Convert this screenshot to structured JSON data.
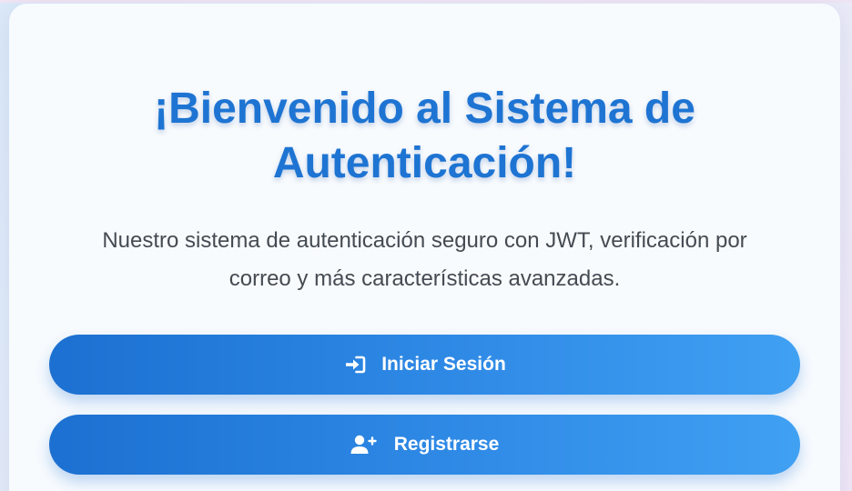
{
  "welcome": {
    "title_line1": "¡Bienvenido al Sistema de",
    "title_line2": "Autenticación!",
    "description_line1": "Nuestro sistema de autenticación seguro con JWT, verificación por",
    "description_line2": "correo y más características avanzadas."
  },
  "actions": {
    "login": {
      "label": "Iniciar Sesión",
      "icon": "sign-in-icon"
    },
    "register": {
      "label": "Registrarse",
      "icon": "user-plus-icon"
    }
  },
  "colors": {
    "title": "#1e74d2",
    "button_gradient_start": "#1c70d1",
    "button_gradient_end": "#40a0f2",
    "text": "#454b52"
  }
}
